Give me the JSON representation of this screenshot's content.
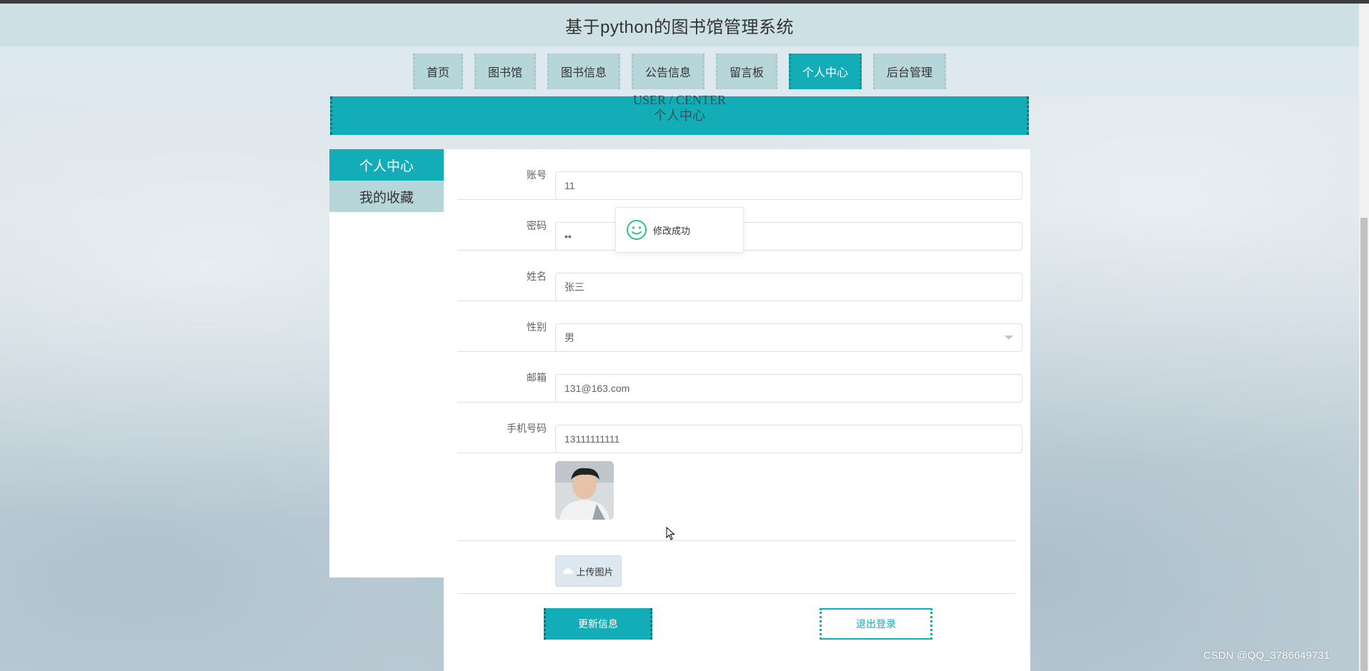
{
  "header": {
    "title": "基于python的图书馆管理系统"
  },
  "nav": {
    "items": [
      {
        "label": "首页"
      },
      {
        "label": "图书馆"
      },
      {
        "label": "图书信息"
      },
      {
        "label": "公告信息"
      },
      {
        "label": "留言板"
      },
      {
        "label": "个人中心"
      },
      {
        "label": "后台管理"
      }
    ],
    "active": "个人中心"
  },
  "banner": {
    "en": "USER / CENTER",
    "cn": "个人中心"
  },
  "sidebar": {
    "items": [
      {
        "label": "个人中心"
      },
      {
        "label": "我的收藏"
      }
    ]
  },
  "form": {
    "account": {
      "label": "账号",
      "value": "11"
    },
    "password": {
      "label": "密码",
      "value": "••"
    },
    "name": {
      "label": "姓名",
      "value": "张三"
    },
    "gender": {
      "label": "性别",
      "value": "男"
    },
    "email": {
      "label": "邮箱",
      "value": "131@163.com"
    },
    "phone": {
      "label": "手机号码",
      "value": "13111111111"
    },
    "upload_label": "上传图片",
    "update_label": "更新信息",
    "logout_label": "退出登录"
  },
  "toast": {
    "message": "修改成功"
  },
  "watermark": "CSDN @QQ_3786649731",
  "colors": {
    "accent": "#13adb8",
    "nav_bg": "#b7d6d9",
    "header_bg": "#cde0e4"
  }
}
